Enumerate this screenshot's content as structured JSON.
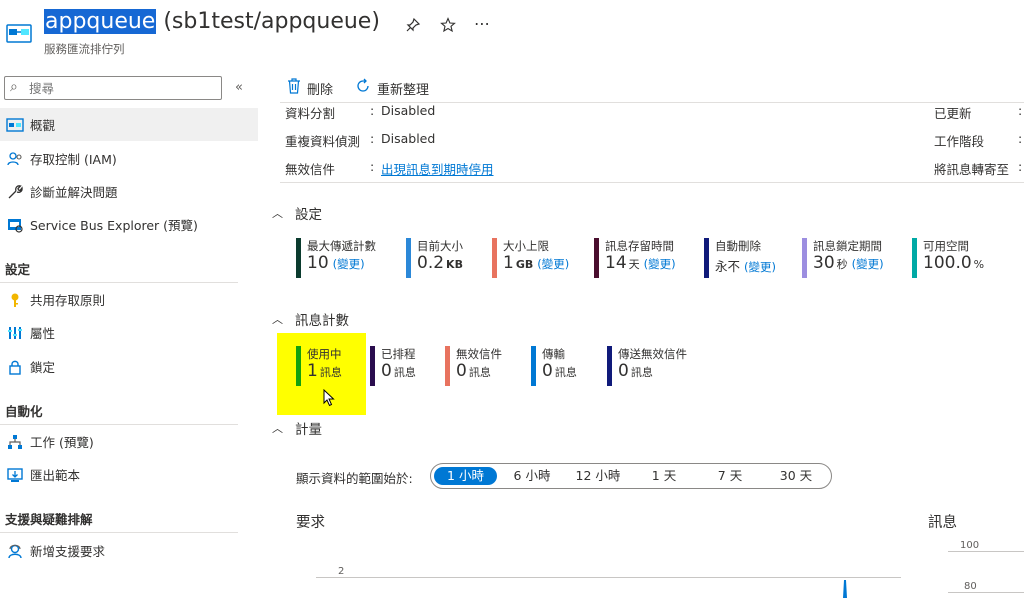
{
  "header": {
    "title_selected": "appqueue",
    "title_rest": "(sb1test/appqueue)",
    "subtitle": "服務匯流排佇列"
  },
  "sidebar": {
    "search_placeholder": "搜尋",
    "items": [
      {
        "label": "概觀",
        "icon": "overview-icon"
      },
      {
        "label": "存取控制 (IAM)",
        "icon": "people-icon"
      },
      {
        "label": "診斷並解決問題",
        "icon": "wrench-icon"
      },
      {
        "label": "Service Bus Explorer (預覽)",
        "icon": "explorer-icon"
      }
    ],
    "sections": [
      {
        "heading": "設定",
        "items": [
          {
            "label": "共用存取原則",
            "icon": "key-icon"
          },
          {
            "label": "屬性",
            "icon": "properties-icon"
          },
          {
            "label": "鎖定",
            "icon": "lock-icon"
          }
        ]
      },
      {
        "heading": "自動化",
        "items": [
          {
            "label": "工作 (預覽)",
            "icon": "tasks-icon"
          },
          {
            "label": "匯出範本",
            "icon": "export-icon"
          }
        ]
      },
      {
        "heading": "支援與疑難排解",
        "items": [
          {
            "label": "新增支援要求",
            "icon": "support-icon"
          }
        ]
      }
    ]
  },
  "toolbar": {
    "delete_label": "刪除",
    "refresh_label": "重新整理"
  },
  "essentials": {
    "rows": [
      {
        "label": "資料分割",
        "value": "Disabled"
      },
      {
        "label": "重複資料偵測",
        "value": "Disabled"
      },
      {
        "label": "無效信件",
        "value": "出現訊息到期時停用"
      }
    ],
    "right_labels": [
      "已更新",
      "工作階段",
      "將訊息轉寄至"
    ]
  },
  "settings": {
    "title": "設定",
    "tiles": [
      {
        "label": "最大傳遞計數",
        "value": "10",
        "unit": "",
        "link": "(變更)",
        "color": "#0b3b2e"
      },
      {
        "label": "目前大小",
        "value": "0.2",
        "unit": "KB",
        "link": "",
        "color": "#2b88d8"
      },
      {
        "label": "大小上限",
        "value": "1",
        "unit": "GB",
        "link": "(變更)",
        "color": "#e8735f"
      },
      {
        "label": "訊息存留時間",
        "value": "14",
        "unit": "天",
        "link": "(變更)",
        "color": "#4a0e2e"
      },
      {
        "label": "自動刪除",
        "value": "永不",
        "unit": "",
        "link": "(變更)",
        "color": "#101a7a"
      },
      {
        "label": "訊息鎖定期間",
        "value": "30",
        "unit": "秒",
        "link": "(變更)",
        "color": "#9c8ee0"
      },
      {
        "label": "可用空間",
        "value": "100.0",
        "unit": "%",
        "link": "",
        "color": "#00a9a5"
      }
    ]
  },
  "message_counts": {
    "title": "訊息計數",
    "tiles": [
      {
        "label": "使用中",
        "value": "1",
        "unit": "訊息",
        "color": "#13a10e"
      },
      {
        "label": "已排程",
        "value": "0",
        "unit": "訊息",
        "color": "#2a0d4e"
      },
      {
        "label": "無效信件",
        "value": "0",
        "unit": "訊息",
        "color": "#e8735f"
      },
      {
        "label": "傳輸",
        "value": "0",
        "unit": "訊息",
        "color": "#0078d4"
      },
      {
        "label": "傳送無效信件",
        "value": "0",
        "unit": "訊息",
        "color": "#101a7a"
      }
    ]
  },
  "metrics": {
    "title": "計量",
    "range_label": "顯示資料的範圍始於:",
    "range_options": [
      "1 小時",
      "6 小時",
      "12 小時",
      "1 天",
      "7 天",
      "30 天"
    ],
    "selected_range": "1 小時",
    "requests_title": "要求",
    "requests_tick": "2",
    "messages_title": "訊息",
    "messages_ticks": [
      "100",
      "80"
    ]
  }
}
